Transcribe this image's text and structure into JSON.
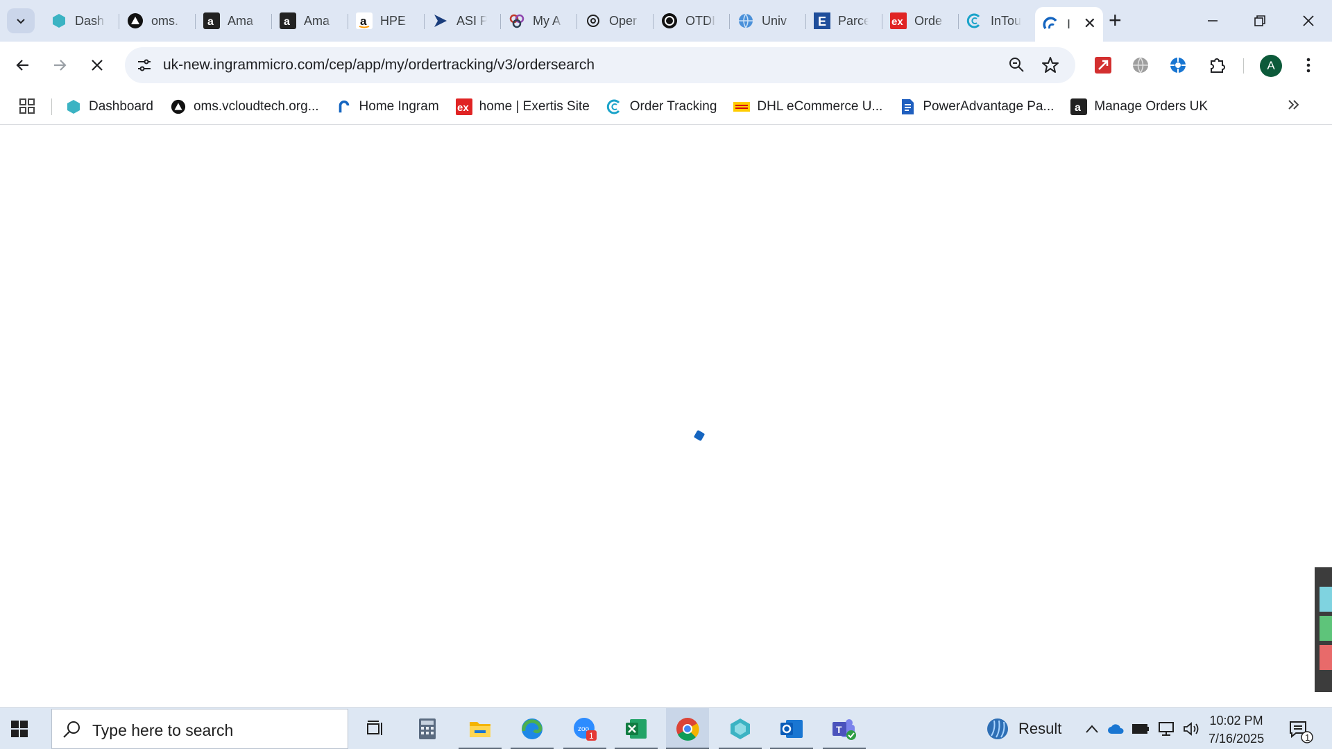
{
  "browser": {
    "tabs": [
      {
        "label": "Dash",
        "icon": "hexagon-icon"
      },
      {
        "label": "oms.",
        "icon": "triangle-circle-icon"
      },
      {
        "label": "Ama",
        "icon": "amazon-icon"
      },
      {
        "label": "Ama",
        "icon": "amazon-icon"
      },
      {
        "label": "HPE",
        "icon": "amazon-small-icon"
      },
      {
        "label": "ASI P",
        "icon": "arrow-play-icon"
      },
      {
        "label": "My A",
        "icon": "rings-icon"
      },
      {
        "label": "Oper",
        "icon": "openai-icon"
      },
      {
        "label": "OTDI",
        "icon": "openai-dark-icon"
      },
      {
        "label": "Univ",
        "icon": "globe-icon"
      },
      {
        "label": "Parce",
        "icon": "letter-e-icon"
      },
      {
        "label": "Orde",
        "icon": "exertis-icon"
      },
      {
        "label": "InTou",
        "icon": "c-swirl-icon"
      },
      {
        "label": "I",
        "icon": "ingram-icon",
        "active": true
      }
    ],
    "new_tab_symbol": "+",
    "close_tab_symbol": "✕",
    "url": "uk-new.ingrammicro.com/cep/app/my/ordertracking/v3/ordersearch",
    "profile_initial": "A"
  },
  "bookmarks": [
    {
      "label": "Dashboard",
      "icon": "hexagon-icon"
    },
    {
      "label": "oms.vcloudtech.org...",
      "icon": "triangle-circle-icon"
    },
    {
      "label": "Home Ingram",
      "icon": "ingram-icon"
    },
    {
      "label": "home | Exertis Site",
      "icon": "exertis-icon"
    },
    {
      "label": "Order Tracking",
      "icon": "c-swirl-icon"
    },
    {
      "label": "DHL eCommerce U...",
      "icon": "dhl-icon"
    },
    {
      "label": "PowerAdvantage Pa...",
      "icon": "document-icon"
    },
    {
      "label": "Manage Orders UK",
      "icon": "amazon-icon"
    }
  ],
  "taskbar": {
    "search_placeholder": "Type here to search",
    "tray_result": "Result",
    "time": "10:02 PM",
    "date": "7/16/2025",
    "notification_count": "1",
    "zoom_badge": "1"
  },
  "colors": {
    "tab_strip": "#dfe7f4",
    "accent": "#1565c0",
    "taskbar": "#dde7f3"
  }
}
